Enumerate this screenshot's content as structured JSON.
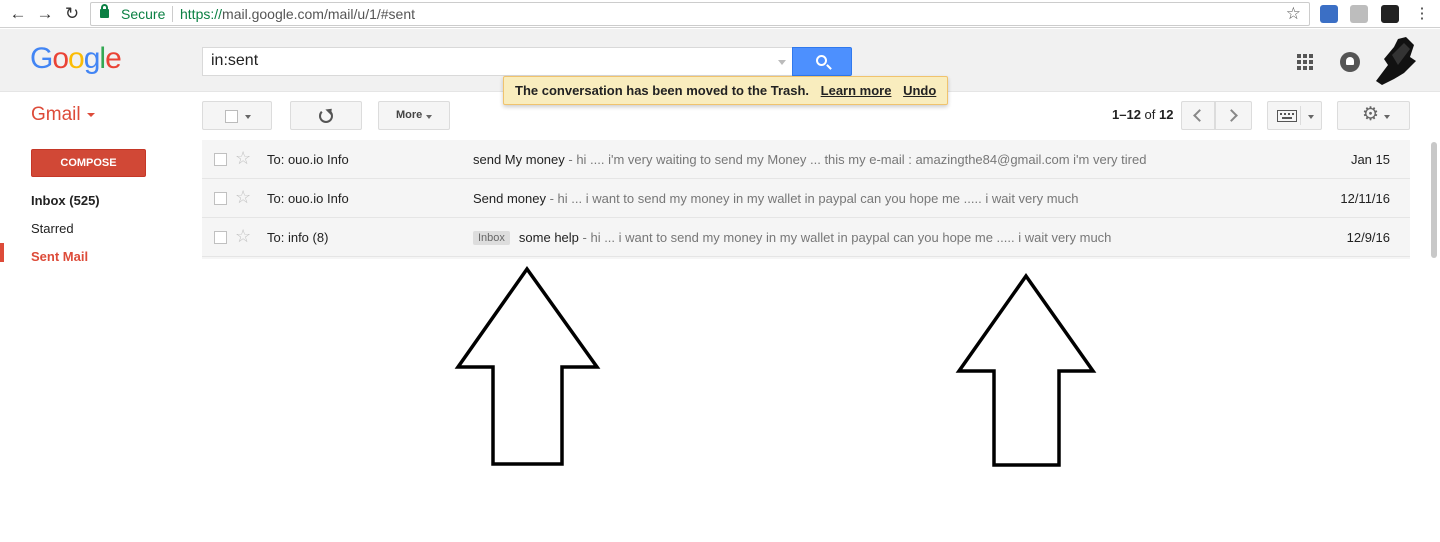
{
  "browser": {
    "secure_label": "Secure",
    "url_scheme": "https://",
    "url_rest": "mail.google.com/mail/u/1/#sent"
  },
  "header": {
    "logo_text": "Google",
    "search_value": "in:sent"
  },
  "toast": {
    "message": "The conversation has been moved to the Trash.",
    "learn_more": "Learn more",
    "undo": "Undo"
  },
  "toolbar": {
    "app_label": "Gmail",
    "more_label": "More",
    "pager_range": "1–12",
    "pager_of": "of",
    "pager_total": "12"
  },
  "sidebar": {
    "compose_label": "COMPOSE",
    "items": [
      {
        "label": "Inbox (525)"
      },
      {
        "label": "Starred"
      },
      {
        "label": "Sent Mail"
      }
    ]
  },
  "messages": [
    {
      "sender": "To: ouo.io Info",
      "label": "",
      "subject": "send My money",
      "snippet": " - hi .... i'm very waiting to send my Money ... this my e-mail : amazingthe84@gmail.com i'm very tired",
      "date": "Jan 15"
    },
    {
      "sender": "To: ouo.io Info",
      "label": "",
      "subject": "Send money",
      "snippet": " - hi ... i want to send my money in my wallet in paypal can you hope me ..... i wait very much",
      "date": "12/11/16"
    },
    {
      "sender": "To: info (8)",
      "label": "Inbox",
      "subject": "some help",
      "snippet": " - hi ... i want to send my money in my wallet in paypal can you hope me ..... i wait very much",
      "date": "12/9/16"
    }
  ],
  "colors": {
    "accent_red": "#dd4b39",
    "search_blue": "#4d90fe",
    "toast_bg": "#f9edbe",
    "secure_green": "#0b8043"
  },
  "icons": [
    "back-arrow-icon",
    "forward-arrow-icon",
    "reload-icon",
    "lock-icon",
    "bookmark-star-icon",
    "search-icon",
    "apps-grid-icon",
    "notifications-icon",
    "refresh-icon",
    "settings-gear-icon",
    "keyboard-icon",
    "star-icon",
    "up-arrow-annotation"
  ]
}
